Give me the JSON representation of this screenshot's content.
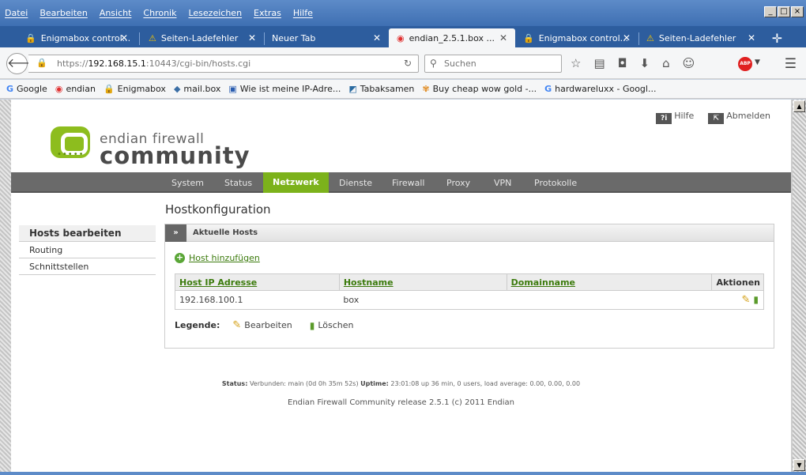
{
  "menubar": {
    "items": [
      "Datei",
      "Bearbeiten",
      "Ansicht",
      "Chronik",
      "Lesezeichen",
      "Extras",
      "Hilfe"
    ]
  },
  "tabs": [
    {
      "label": "Enigmabox control...",
      "icon": "lock-icon"
    },
    {
      "label": "Seiten-Ladefehler",
      "icon": "warning-icon"
    },
    {
      "label": "Neuer Tab",
      "icon": ""
    },
    {
      "label": "endian_2.5.1.box ...",
      "icon": "endian-icon",
      "active": true
    },
    {
      "label": "Enigmabox control...",
      "icon": "lock-icon"
    },
    {
      "label": "Seiten-Ladefehler",
      "icon": "warning-icon"
    }
  ],
  "navbar": {
    "url_prefix": "https://",
    "url_host": "192.168.15.1",
    "url_rest": ":10443/cgi-bin/hosts.cgi",
    "search_placeholder": "Suchen"
  },
  "bookmarks": [
    {
      "label": "Google",
      "icon": "google-icon"
    },
    {
      "label": "endian",
      "icon": "endian-icon"
    },
    {
      "label": "Enigmabox",
      "icon": "lock-icon"
    },
    {
      "label": "mail.box",
      "icon": "mail-icon"
    },
    {
      "label": "Wie ist meine IP-Adre...",
      "icon": "monitor-icon"
    },
    {
      "label": "Tabaksamen",
      "icon": "leaf-icon"
    },
    {
      "label": "Buy cheap wow gold -...",
      "icon": "flower-icon"
    },
    {
      "label": "hardwareluxx - Googl...",
      "icon": "google-icon"
    }
  ],
  "header": {
    "help": "Hilfe",
    "logout": "Abmelden"
  },
  "logo": {
    "line1": "endian firewall",
    "line2": "community"
  },
  "mainnav": [
    "System",
    "Status",
    "Netzwerk",
    "Dienste",
    "Firewall",
    "Proxy",
    "VPN",
    "Protokolle"
  ],
  "page": {
    "title": "Hostkonfiguration"
  },
  "sidebar": [
    "Hosts bearbeiten",
    "Routing",
    "Schnittstellen"
  ],
  "panel": {
    "title": "Aktuelle Hosts",
    "add_host": "Host hinzufügen",
    "columns": [
      "Host IP Adresse",
      "Hostname",
      "Domainname",
      "Aktionen"
    ],
    "rows": [
      {
        "ip": "192.168.100.1",
        "hostname": "box",
        "domain": ""
      }
    ],
    "legend_title": "Legende:",
    "legend_edit": "Bearbeiten",
    "legend_delete": "Löschen"
  },
  "status": {
    "status_label": "Status:",
    "status_value": "Verbunden: main (0d 0h 35m 52s)",
    "uptime_label": "Uptime:",
    "uptime_value": "23:01:08 up 36 min, 0 users, load average: 0.00, 0.00, 0.00"
  },
  "footer": "Endian Firewall Community release 2.5.1 (c) 2011 Endian"
}
